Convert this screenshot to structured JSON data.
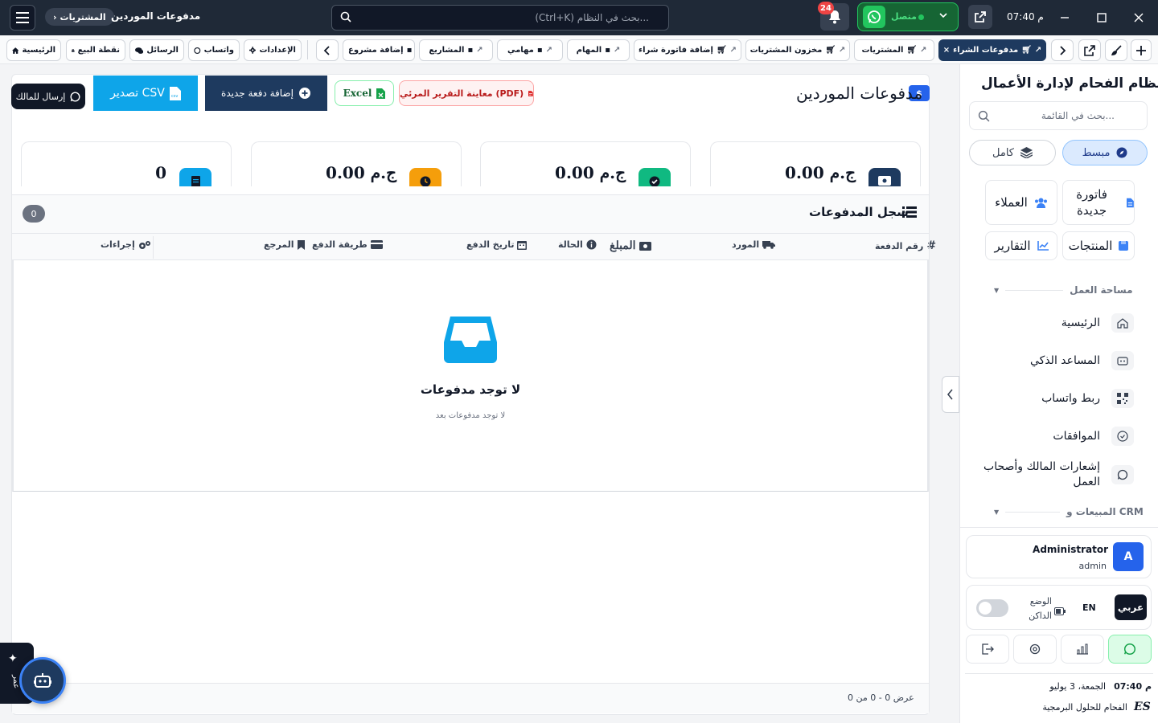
{
  "titlebar": {
    "breadcrumb_parent": "المشتريات",
    "page_title": "مدفوعات الموردين",
    "search_placeholder": "(Ctrl+K) بحث في النظام...",
    "notifications_count": "24",
    "whatsapp_status": "متصل",
    "time": "07:40 م"
  },
  "tabs": {
    "open": [
      {
        "label": "مدفوعات الشراء",
        "active": true
      },
      {
        "label": "المشتريات"
      },
      {
        "label": "مخزون المشتريات"
      },
      {
        "label": "إضافة فاتورة شراء"
      },
      {
        "label": "المهام"
      },
      {
        "label": "مهامي"
      },
      {
        "label": "المشاريع"
      },
      {
        "label": "إضافة مشروع"
      }
    ],
    "quick": [
      {
        "label": "الإعدادات"
      },
      {
        "label": "واتساب"
      },
      {
        "label": "الرسائل"
      },
      {
        "label": "نقطة البيع"
      },
      {
        "label": "الرئيسية"
      }
    ]
  },
  "main": {
    "title": "مدفوعات الموردين",
    "title_badge": "$",
    "buttons": {
      "pdf": "معاينة التقرير المرئي (PDF)",
      "excel": "Excel",
      "add": "إضافة دفعة جديدة",
      "csv": "تصدير CSV",
      "owner": "إرسال للمالك"
    },
    "stats": [
      {
        "value": "0.00 ج.م",
        "icon": "money-icon",
        "color": "#1e3a5f"
      },
      {
        "value": "0.00 ج.م",
        "icon": "check-icon",
        "color": "#10b981"
      },
      {
        "value": "0.00 ج.م",
        "icon": "clock-icon",
        "color": "#f59e0b"
      },
      {
        "value": "0",
        "icon": "document-icon",
        "color": "#0ea5e9"
      }
    ],
    "section_title": "سجل المدفوعات",
    "section_count": "0",
    "columns": [
      "رقم الدفعة",
      "المورد",
      "المبلغ",
      "الحالة",
      "تاريخ الدفع",
      "طريقة الدفع",
      "المرجع",
      "إجراءات"
    ],
    "empty_title": "لا توجد مدفوعات",
    "empty_subtitle": "لا توجد مدفوعات بعد",
    "footer": "عرض 0 - 0 من 0"
  },
  "fab": {
    "label": "عمر"
  },
  "sidebar": {
    "brand": "نظام الفحام لإدارة الأعمال",
    "search_placeholder": "بحث في القائمة...",
    "mode_active": "مبسط",
    "mode_full": "كامل",
    "quick_actions": [
      "فاتورة جديدة",
      "العملاء",
      "المنتجات",
      "التقارير"
    ],
    "section_workspace": "مساحة العمل",
    "items": [
      {
        "label": "الرئيسية"
      },
      {
        "label": "المساعد الذكي"
      },
      {
        "label": "ربط واتساب"
      },
      {
        "label": "الموافقات"
      },
      {
        "label": "إشعارات المالك وأصحاب العمل"
      }
    ],
    "section_sales": "المبيعات و CRM",
    "user": {
      "initial": "A",
      "name": "Administrator",
      "role": "admin"
    },
    "lang_ar": "عربي",
    "lang_en": "EN",
    "dark_mode": "الوضع الداكن",
    "clock_time": "07:40 م",
    "clock_date": "الجمعة، 3 يوليو",
    "company": "الفحام للحلول البرمجية",
    "company_logo": "ES"
  }
}
